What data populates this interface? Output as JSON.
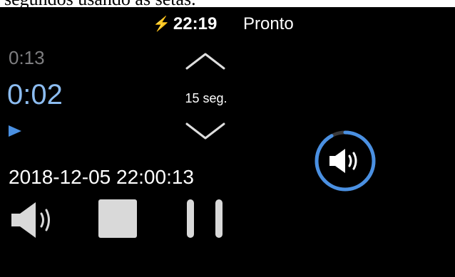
{
  "caption": {
    "text": "segundos usando as setas."
  },
  "status_bar": {
    "time": "22:19",
    "title": "Pronto"
  },
  "timer": {
    "elapsed_small": "0:13",
    "elapsed_big": "0:02",
    "interval_label": "15 seg."
  },
  "timestamp": "2018-12-05 22:00:13",
  "colors": {
    "accent": "#4a90e2",
    "elapsed_big": "#8cbcf0",
    "charging": "#3fd14a",
    "control": "#d9d9d9"
  },
  "icons": [
    "charging-bolt-icon",
    "play-indicator-icon",
    "chevron-up-icon",
    "chevron-down-icon",
    "speaker-icon",
    "stop-icon",
    "pause-icon"
  ],
  "progress_ring": {
    "fraction": 0.92
  }
}
